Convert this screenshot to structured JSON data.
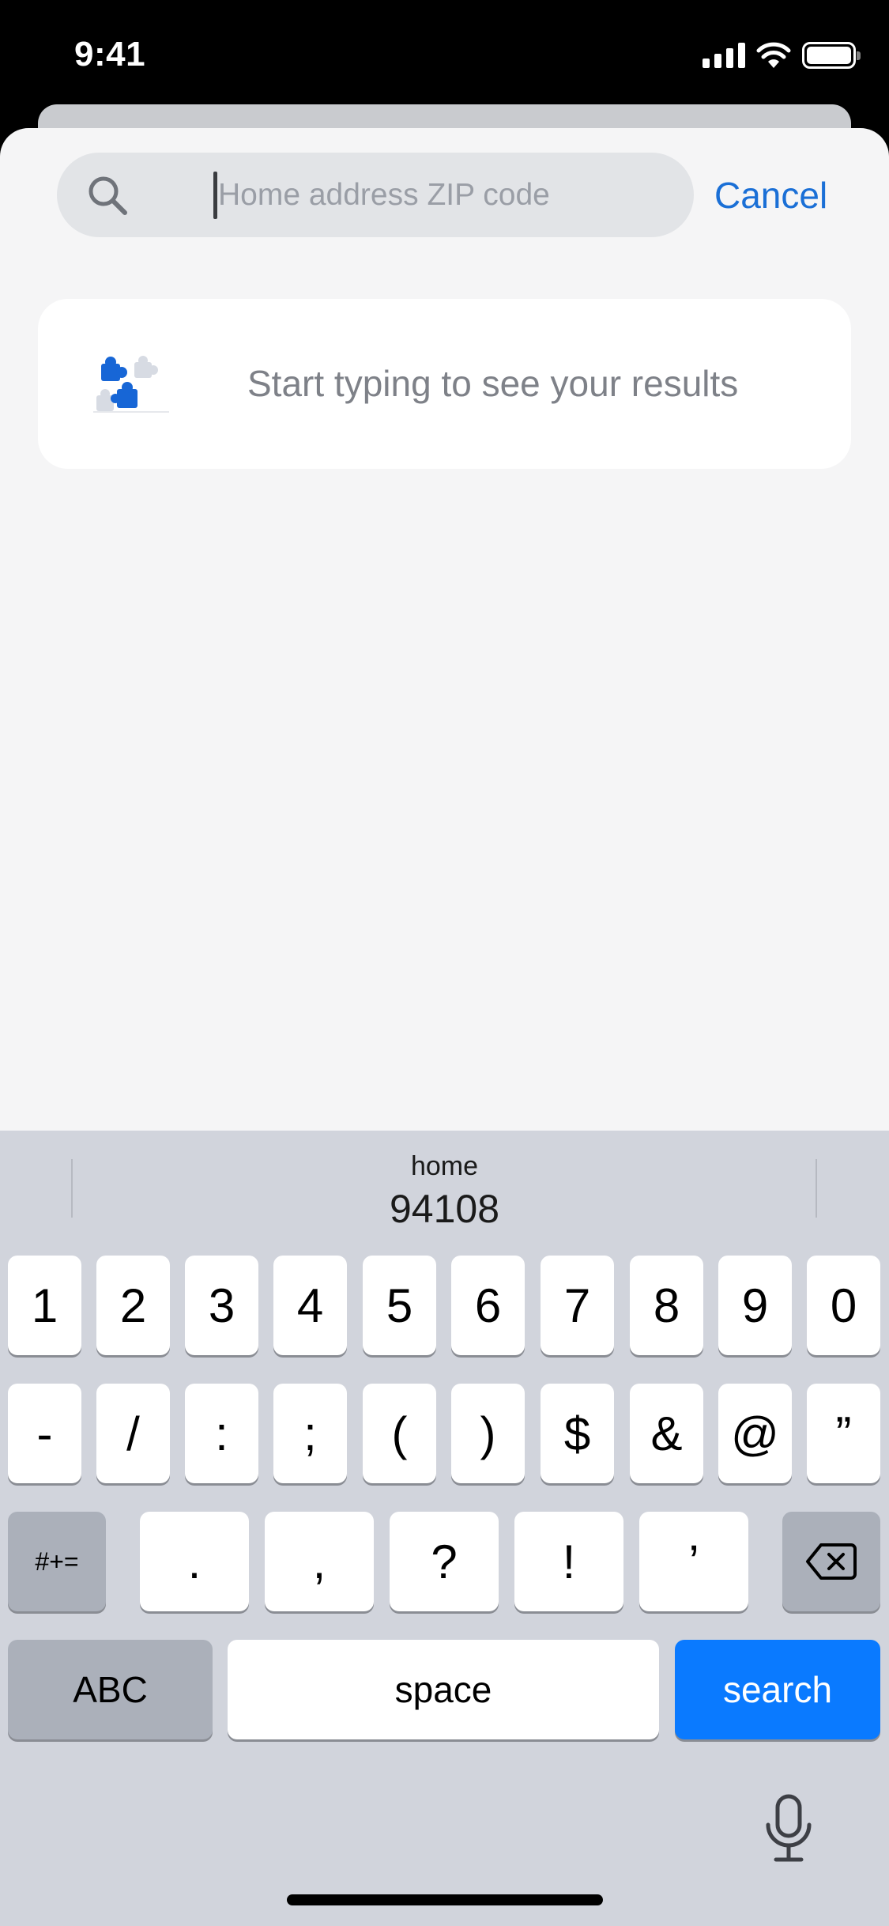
{
  "status_bar": {
    "time": "9:41"
  },
  "search": {
    "placeholder": "Home address ZIP code",
    "value": "",
    "cancel_label": "Cancel"
  },
  "empty_state": {
    "message": "Start typing to see your results"
  },
  "keyboard": {
    "suggestion": {
      "label": "home",
      "value": "94108"
    },
    "row1": [
      "1",
      "2",
      "3",
      "4",
      "5",
      "6",
      "7",
      "8",
      "9",
      "0"
    ],
    "row2": [
      "-",
      "/",
      ":",
      ";",
      "(",
      ")",
      "$",
      "&",
      "@",
      "”"
    ],
    "row3": {
      "symbols_label": "#+=",
      "keys": [
        ".",
        ",",
        "?",
        "!",
        "’"
      ]
    },
    "row4": {
      "abc_label": "ABC",
      "space_label": "space",
      "search_label": "search"
    }
  },
  "colors": {
    "accent": "#1a6fd6",
    "search_key": "#0a7aff",
    "puzzle_blue": "#1766d6",
    "puzzle_light": "#d7dbe3"
  },
  "icons": {
    "search": "search-icon",
    "empty_state": "puzzle-icon",
    "delete": "delete-icon",
    "dictation": "microphone-icon"
  }
}
